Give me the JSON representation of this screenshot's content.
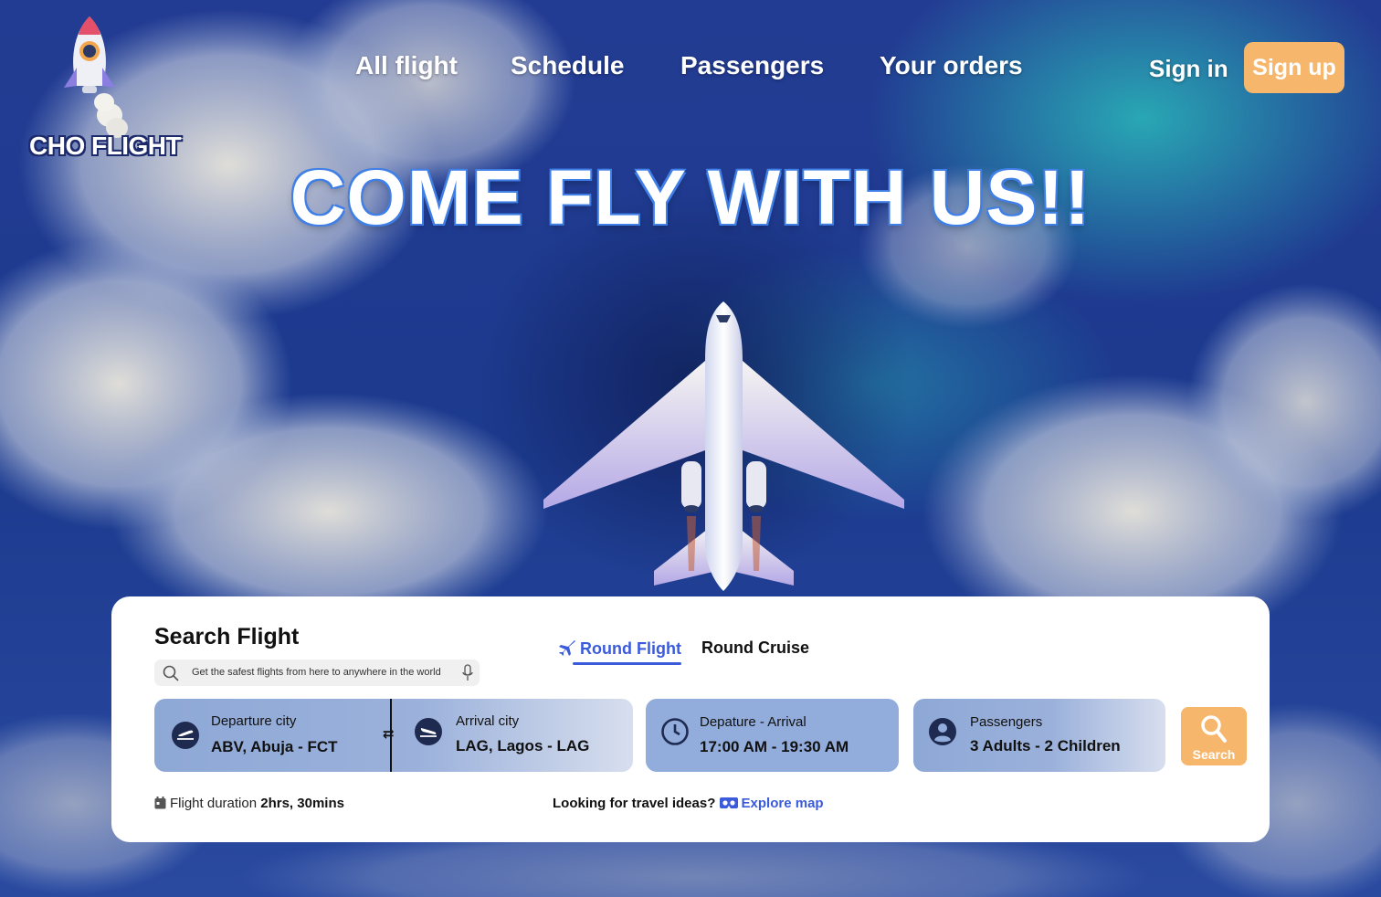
{
  "brand": {
    "name": "CHO FLIGHT"
  },
  "nav": {
    "links": [
      "All flight",
      "Schedule",
      "Passengers",
      "Your orders"
    ],
    "sign_in": "Sign in",
    "sign_up": "Sign up"
  },
  "hero": {
    "headline": "COME FLY WITH US!!"
  },
  "search_card": {
    "title": "Search Flight",
    "search_placeholder": "Get the safest flights from here to anywhere in the world",
    "tabs": {
      "round_flight": "Round Flight",
      "round_cruise": "Round Cruise",
      "active": "Round Flight"
    },
    "departure": {
      "label": "Departure city",
      "value": "ABV, Abuja - FCT",
      "icon": "plane-takeoff-icon"
    },
    "swap_symbol": "⇄",
    "arrival": {
      "label": "Arrival city",
      "value": "LAG, Lagos - LAG",
      "icon": "plane-landing-icon"
    },
    "time": {
      "label": "Depature - Arrival",
      "value": "17:00 AM - 19:30 AM",
      "icon": "clock-icon"
    },
    "passengers": {
      "label": "Passengers",
      "value": "3 Adults - 2 Children",
      "icon": "user-icon"
    },
    "search_button": "Search",
    "duration_label": "Flight duration",
    "duration_value": "2hrs, 30mins",
    "ideas_text": "Looking for travel ideas?",
    "explore_link": "Explore map"
  },
  "colors": {
    "accent": "#f6b66b",
    "link": "#3b5bdb",
    "field": "#92acdb",
    "sky": "#1b3a8f"
  }
}
